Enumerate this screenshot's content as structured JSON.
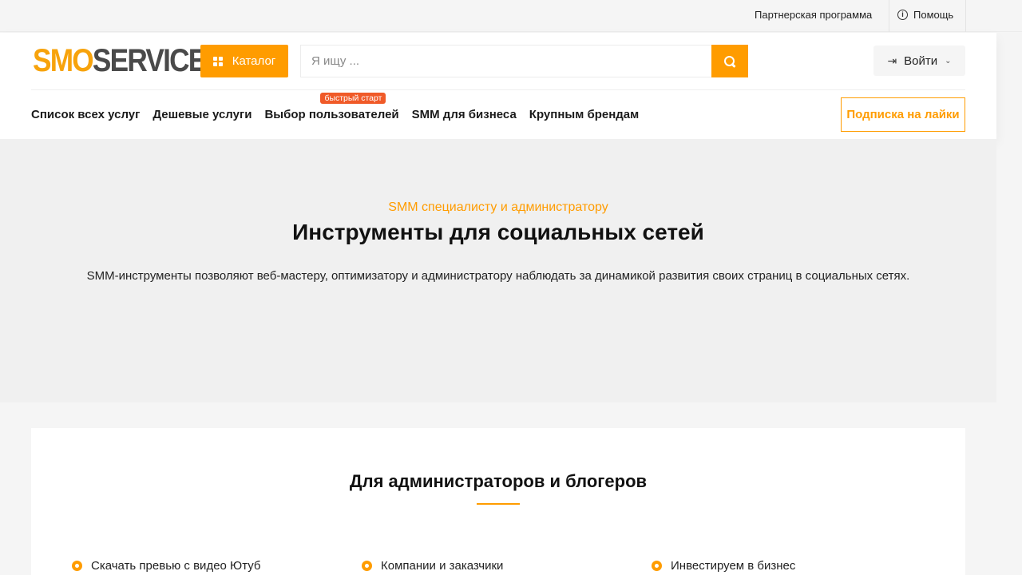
{
  "topbar": {
    "partner_label": "Партнерская программа",
    "help_label": "Помощь"
  },
  "header": {
    "logo_part1": "SMO",
    "logo_part2": "SERVICE",
    "catalog_label": "Каталог",
    "search_placeholder": "Я ищу ...",
    "login_label": "Войти",
    "subscribe_label": "Подписка на лайки"
  },
  "nav": {
    "items": [
      {
        "label": "Список всех услуг"
      },
      {
        "label": "Дешевые услуги"
      },
      {
        "label": "Выбор пользователей",
        "badge": "быстрый старт"
      },
      {
        "label": "SMM для бизнеса"
      },
      {
        "label": "Крупным брендам"
      }
    ]
  },
  "hero": {
    "kicker": "SMM специалисту и администратору",
    "title": "Инструменты для социальных сетей",
    "description": "SMM-инструменты позволяют веб-мастеру, оптимизатору и администратору наблюдать за динамикой развития своих страниц в социальных сетях."
  },
  "section": {
    "title": "Для администраторов и блогеров",
    "items": [
      {
        "label": "Скачать превью с видео Ютуб"
      },
      {
        "label": "Компании и заказчики"
      },
      {
        "label": "Инвестируем в бизнес"
      }
    ]
  },
  "colors": {
    "accent": "#ff9c00",
    "badge": "#f05a28",
    "logo_dark": "#4a4a4a"
  }
}
